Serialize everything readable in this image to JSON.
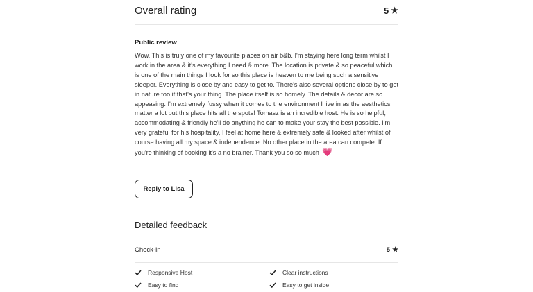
{
  "overall": {
    "title": "Overall rating",
    "rating": "5",
    "star_icon": "star-icon"
  },
  "review": {
    "heading": "Public review",
    "text": "Wow. This is truly one of my favourite places on air b&b. I'm staying here long term whilst I work in the area & it's everything I need & more. The location is private & so peaceful which is one of the main things I look for so this place is heaven to me being such a sensitive sleeper. Everything is close by and easy to get to. There's also several options close by to get in nature too if that's your thing. The place itself is so homely. The details & decor are so appeasing. I'm extremely fussy when it comes to the environment I live in as the aesthetics matter a lot but this place hits all the spots! Tomasz is an incredible host. He is so helpful, accommodating & friendly he'll do anything he can to make your stay the best possible. I'm very grateful for his hospitality, I feel at home here & extremely safe & looked after whilst of course having all my space & independence. No other place in the area can compete. If you're thinking of booking it's a no brainer. Thank you so so much",
    "emoji": "💗",
    "reply_label": "Reply to Lisa"
  },
  "feedback": {
    "title": "Detailed feedback",
    "category": "Check-in",
    "rating": "5",
    "tags": [
      "Responsive Host",
      "Clear instructions",
      "Easy to find",
      "Easy to get inside"
    ]
  },
  "colors": {
    "text": "#222222",
    "heart": "#e0348a",
    "divider": "#e6e6e6"
  }
}
